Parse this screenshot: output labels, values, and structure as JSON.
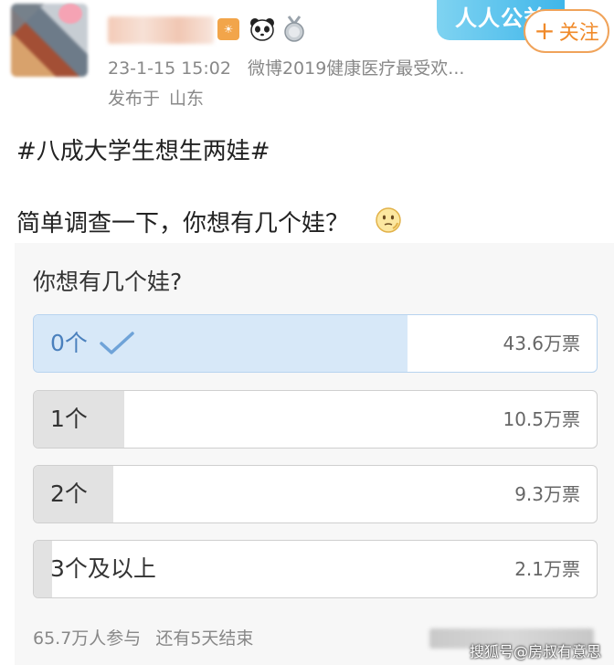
{
  "post": {
    "meta": {
      "datetime": "23-1-15 15:02",
      "source": "微博2019健康医疗最受欢...",
      "location_prefix": "发布于",
      "location": "山东"
    },
    "promo_banner": "人人公益",
    "follow_label": "关注",
    "hashtag": "#八成大学生想生两娃#",
    "text": "简单调查一下，你想有几个娃？",
    "emoji": "thinking-face-emoji"
  },
  "poll": {
    "question": "你想有几个娃?",
    "options": [
      {
        "label": "0个",
        "votes": "43.6万票",
        "share": 0.664,
        "selected": true
      },
      {
        "label": "1个",
        "votes": "10.5万票",
        "share": 0.16,
        "selected": false
      },
      {
        "label": "2个",
        "votes": "9.3万票",
        "share": 0.141,
        "selected": false
      },
      {
        "label": "3个及以上",
        "votes": "2.1万票",
        "share": 0.032,
        "selected": false
      }
    ],
    "participants": "65.7万人参与",
    "remaining": "还有5天结束"
  },
  "watermark": "搜狐号@房叔有意思",
  "colors": {
    "accent": "#f08a2a",
    "selected_fill": "#d7e8f8",
    "selected_text": "#4a80bd",
    "bar_fill": "#e2e2e2"
  }
}
